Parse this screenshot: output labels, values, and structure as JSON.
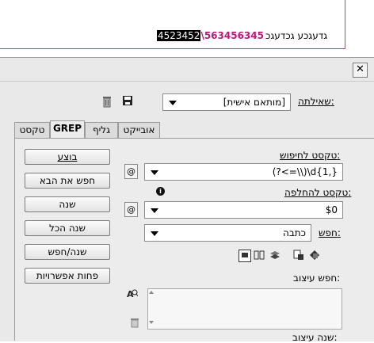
{
  "document": {
    "text_black_highlight": "4523452",
    "text_magenta": "\\563456345",
    "text_plain": "גדעגכע גכדעגכ"
  },
  "dialog": {
    "close_glyph": "✕",
    "query_label": "שאילתה:",
    "query_value": "[מותאם אישית]",
    "tabs": [
      "טקסט",
      "GREP",
      "גליף",
      "אובייקט"
    ],
    "active_tab": "GREP",
    "find_label": "טקסט לחיפוש:",
    "find_value": "(?<=\\\\)\\d{1,}",
    "change_label": "טקסט להחלפה:",
    "change_value": "$0",
    "search_label": "חפש:",
    "search_value": "כתבה",
    "find_format_label": "חפש עיצוב:",
    "change_format_label": "שנה עיצוב:",
    "buttons": {
      "done": "בוצע",
      "find_next": "חפש את הבא",
      "change": "שנה",
      "change_all": "שנה הכל",
      "change_find": "שנה/חפש",
      "fewer_options": "פחות אפשרויות"
    },
    "icons": {
      "save": "save-icon",
      "delete": "trash-icon",
      "special_chars": "at-sign-icon",
      "info": "info-icon",
      "format_spec": "format-search-icon"
    }
  }
}
